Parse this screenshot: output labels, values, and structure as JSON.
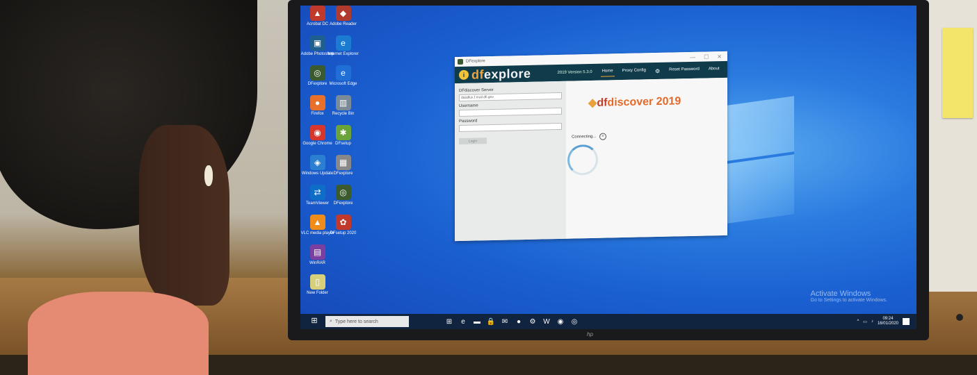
{
  "desktop": {
    "icons": [
      [
        {
          "label": "Acrobat DC",
          "glyph": "▲",
          "color": "#c0392b"
        },
        {
          "label": "Adobe Reader",
          "glyph": "◆",
          "color": "#b03a2e"
        }
      ],
      [
        {
          "label": "Adobe Photoshop",
          "glyph": "▣",
          "color": "#1e5f8f"
        },
        {
          "label": "Internet Explorer",
          "glyph": "e",
          "color": "#1b7bd1"
        }
      ],
      [
        {
          "label": "DFexplore",
          "glyph": "◎",
          "color": "#3b5a2d"
        },
        {
          "label": "Microsoft Edge",
          "glyph": "e",
          "color": "#1f6fd6"
        }
      ],
      [
        {
          "label": "Firefox",
          "glyph": "●",
          "color": "#e8702a"
        },
        {
          "label": "Recycle Bin",
          "glyph": "▥",
          "color": "#7a8a96"
        }
      ],
      [
        {
          "label": "Google Chrome",
          "glyph": "◉",
          "color": "#d9362b"
        },
        {
          "label": "DFsetup",
          "glyph": "✱",
          "color": "#6aa33a"
        }
      ],
      [
        {
          "label": "Windows Update",
          "glyph": "◈",
          "color": "#2a7fd0"
        },
        {
          "label": "DFexplore",
          "glyph": "▦",
          "color": "#888"
        }
      ],
      [
        {
          "label": "TeamViewer",
          "glyph": "⇄",
          "color": "#0e6ec7"
        },
        {
          "label": "DFexplore",
          "glyph": "◎",
          "color": "#3b5a2d"
        }
      ],
      [
        {
          "label": "VLC media player",
          "glyph": "▲",
          "color": "#f08c1a"
        },
        {
          "label": "DFsetup 2020",
          "glyph": "✿",
          "color": "#c0392b"
        }
      ],
      [
        {
          "label": "WinRAR",
          "glyph": "▤",
          "color": "#7b3fa0"
        }
      ],
      [
        {
          "label": "New Folder",
          "glyph": "▯",
          "color": "#d8cf7a"
        }
      ]
    ]
  },
  "app": {
    "window_title": "DFexplore",
    "logo_prefix": "df",
    "logo_suffix": "explore",
    "version": "2019 Version 5.3.0",
    "nav": [
      "Home",
      "Proxy Config",
      "Reset Password",
      "About"
    ],
    "server_label": "DFdiscover Server",
    "server_value": "dataflux.f.mail.dfi.gov",
    "username_label": "Username",
    "password_label": "Password",
    "login_label": "Login",
    "brand_df": "df",
    "brand_rest": "discover 2019",
    "status": "Connecting...",
    "controls": [
      "—",
      "☐",
      "✕"
    ]
  },
  "taskbar": {
    "search_placeholder": "Type here to search",
    "apps": [
      "⊞",
      "e",
      "▬",
      "🔒",
      "✉",
      "●",
      "⚙",
      "W",
      "◉",
      "◎"
    ],
    "time": "09:24",
    "date": "16/01/2020"
  },
  "watermark": {
    "line1": "Activate Windows",
    "line2": "Go to Settings to activate Windows."
  },
  "monitor_brand": "hp"
}
